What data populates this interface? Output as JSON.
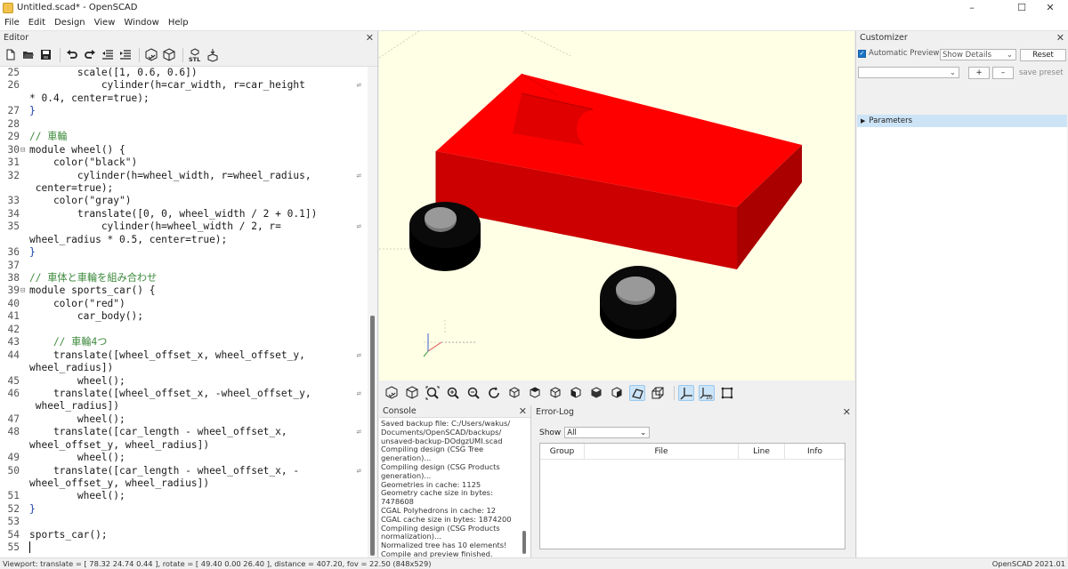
{
  "window": {
    "title": "Untitled.scad* - OpenSCAD",
    "minimize": "–",
    "maximize": "☐",
    "close": "✕"
  },
  "menu": [
    "File",
    "Edit",
    "Design",
    "View",
    "Window",
    "Help"
  ],
  "editor": {
    "title": "Editor",
    "close": "✕",
    "lines": [
      {
        "n": "25",
        "fold": "",
        "text": "        scale([1, 0.6, 0.6])",
        "wrap": false
      },
      {
        "n": "26",
        "fold": "",
        "text": "            cylinder(h=car_width, r=car_height",
        "wrap": true
      },
      {
        "n": "",
        "fold": "",
        "text": "* 0.4, center=true);",
        "wrap": false
      },
      {
        "n": "27",
        "fold": "",
        "text": "}",
        "wrap": false,
        "brace": true
      },
      {
        "n": "28",
        "fold": "",
        "text": "",
        "wrap": false
      },
      {
        "n": "29",
        "fold": "",
        "text": "// 車輪",
        "wrap": false,
        "comment": true
      },
      {
        "n": "30",
        "fold": "⊟",
        "text": "module wheel() {",
        "wrap": false
      },
      {
        "n": "31",
        "fold": "",
        "text": "    color(\"black\")",
        "wrap": false
      },
      {
        "n": "32",
        "fold": "",
        "text": "        cylinder(h=wheel_width, r=wheel_radius,",
        "wrap": true
      },
      {
        "n": "",
        "fold": "",
        "text": " center=true);",
        "wrap": false
      },
      {
        "n": "33",
        "fold": "",
        "text": "    color(\"gray\")",
        "wrap": false
      },
      {
        "n": "34",
        "fold": "",
        "text": "        translate([0, 0, wheel_width / 2 + 0.1])",
        "wrap": false
      },
      {
        "n": "35",
        "fold": "",
        "text": "            cylinder(h=wheel_width / 2, r=",
        "wrap": true
      },
      {
        "n": "",
        "fold": "",
        "text": "wheel_radius * 0.5, center=true);",
        "wrap": false
      },
      {
        "n": "36",
        "fold": "",
        "text": "}",
        "wrap": false,
        "brace": true
      },
      {
        "n": "37",
        "fold": "",
        "text": "",
        "wrap": false
      },
      {
        "n": "38",
        "fold": "",
        "text": "// 車体と車輪を組み合わせ",
        "wrap": false,
        "comment": true
      },
      {
        "n": "39",
        "fold": "⊟",
        "text": "module sports_car() {",
        "wrap": false
      },
      {
        "n": "40",
        "fold": "",
        "text": "    color(\"red\")",
        "wrap": false
      },
      {
        "n": "41",
        "fold": "",
        "text": "        car_body();",
        "wrap": false
      },
      {
        "n": "42",
        "fold": "",
        "text": "",
        "wrap": false
      },
      {
        "n": "43",
        "fold": "",
        "text": "    // 車輪4つ",
        "wrap": false,
        "comment": true
      },
      {
        "n": "44",
        "fold": "",
        "text": "    translate([wheel_offset_x, wheel_offset_y,",
        "wrap": true
      },
      {
        "n": "",
        "fold": "",
        "text": "wheel_radius])",
        "wrap": false
      },
      {
        "n": "45",
        "fold": "",
        "text": "        wheel();",
        "wrap": false
      },
      {
        "n": "46",
        "fold": "",
        "text": "    translate([wheel_offset_x, -wheel_offset_y,",
        "wrap": true
      },
      {
        "n": "",
        "fold": "",
        "text": " wheel_radius])",
        "wrap": false
      },
      {
        "n": "47",
        "fold": "",
        "text": "        wheel();",
        "wrap": false
      },
      {
        "n": "48",
        "fold": "",
        "text": "    translate([car_length - wheel_offset_x,",
        "wrap": true
      },
      {
        "n": "",
        "fold": "",
        "text": "wheel_offset_y, wheel_radius])",
        "wrap": false
      },
      {
        "n": "49",
        "fold": "",
        "text": "        wheel();",
        "wrap": false
      },
      {
        "n": "50",
        "fold": "",
        "text": "    translate([car_length - wheel_offset_x, -",
        "wrap": true
      },
      {
        "n": "",
        "fold": "",
        "text": "wheel_offset_y, wheel_radius])",
        "wrap": false
      },
      {
        "n": "51",
        "fold": "",
        "text": "        wheel();",
        "wrap": false
      },
      {
        "n": "52",
        "fold": "",
        "text": "}",
        "wrap": false,
        "brace": true
      },
      {
        "n": "53",
        "fold": "",
        "text": "",
        "wrap": false
      },
      {
        "n": "54",
        "fold": "",
        "text": "sports_car();",
        "wrap": false
      },
      {
        "n": "55",
        "fold": "",
        "text": "",
        "wrap": false,
        "cursor": true
      }
    ],
    "toolbar_icons": [
      "new-file-icon",
      "open-file-icon",
      "save-icon",
      "undo-icon",
      "redo-icon",
      "unindent-icon",
      "indent-icon",
      "preview-icon",
      "render-icon",
      "export-stl-icon",
      "send-to-print-icon"
    ]
  },
  "viewport_toolbar": [
    "preview-icon",
    "render-icon",
    "view-all-icon",
    "zoom-in-icon",
    "zoom-out-icon",
    "reset-view-icon",
    "view-right-icon",
    "view-top-icon",
    "view-bottom-icon",
    "view-left-icon",
    "view-front-icon",
    "view-back-icon",
    "perspective-icon",
    "orthogonal-icon",
    "show-axes-icon",
    "show-scale-icon",
    "show-edges-icon"
  ],
  "console": {
    "title": "Console",
    "close": "✕",
    "lines": [
      "Saved backup file: C:/Users/wakus/",
      "Documents/OpenSCAD/backups/",
      "unsaved-backup-DOdgzUMI.scad",
      "Compiling design (CSG Tree",
      "generation)...",
      "Compiling design (CSG Products",
      "generation)...",
      "Geometries in cache: 1125",
      "Geometry cache size in bytes:",
      "7478608",
      "CGAL Polyhedrons in cache: 12",
      "CGAL cache size in bytes: 1874200",
      "Compiling design (CSG Products",
      "normalization)...",
      "Normalized tree has 10 elements!",
      "Compile and preview finished."
    ]
  },
  "errorlog": {
    "title": "Error-Log",
    "close": "✕",
    "show_label": "Show",
    "show_value": "All",
    "columns": [
      "Group",
      "File",
      "Line",
      "Info"
    ]
  },
  "customizer": {
    "title": "Customizer",
    "close": "✕",
    "auto_preview_label": "Automatic Preview",
    "auto_preview_checked": true,
    "details_value": "Show Details",
    "reset_label": "Reset",
    "preset_value": "",
    "add_label": "+",
    "remove_label": "–",
    "save_preset_label": "save preset",
    "parameters_label": "Parameters"
  },
  "status": {
    "left": "Viewport: translate = [ 78.32 24.74 0.44 ], rotate = [ 49.40 0.00 26.40 ], distance = 407.20, fov = 22.50 (848x529)",
    "right": "OpenSCAD 2021.01"
  },
  "colors": {
    "viewport_bg": "#ffffe5",
    "car_body": "#ff0000",
    "wheel": "#000000",
    "hubcap": "#999999",
    "accent": "#1a73c8"
  }
}
